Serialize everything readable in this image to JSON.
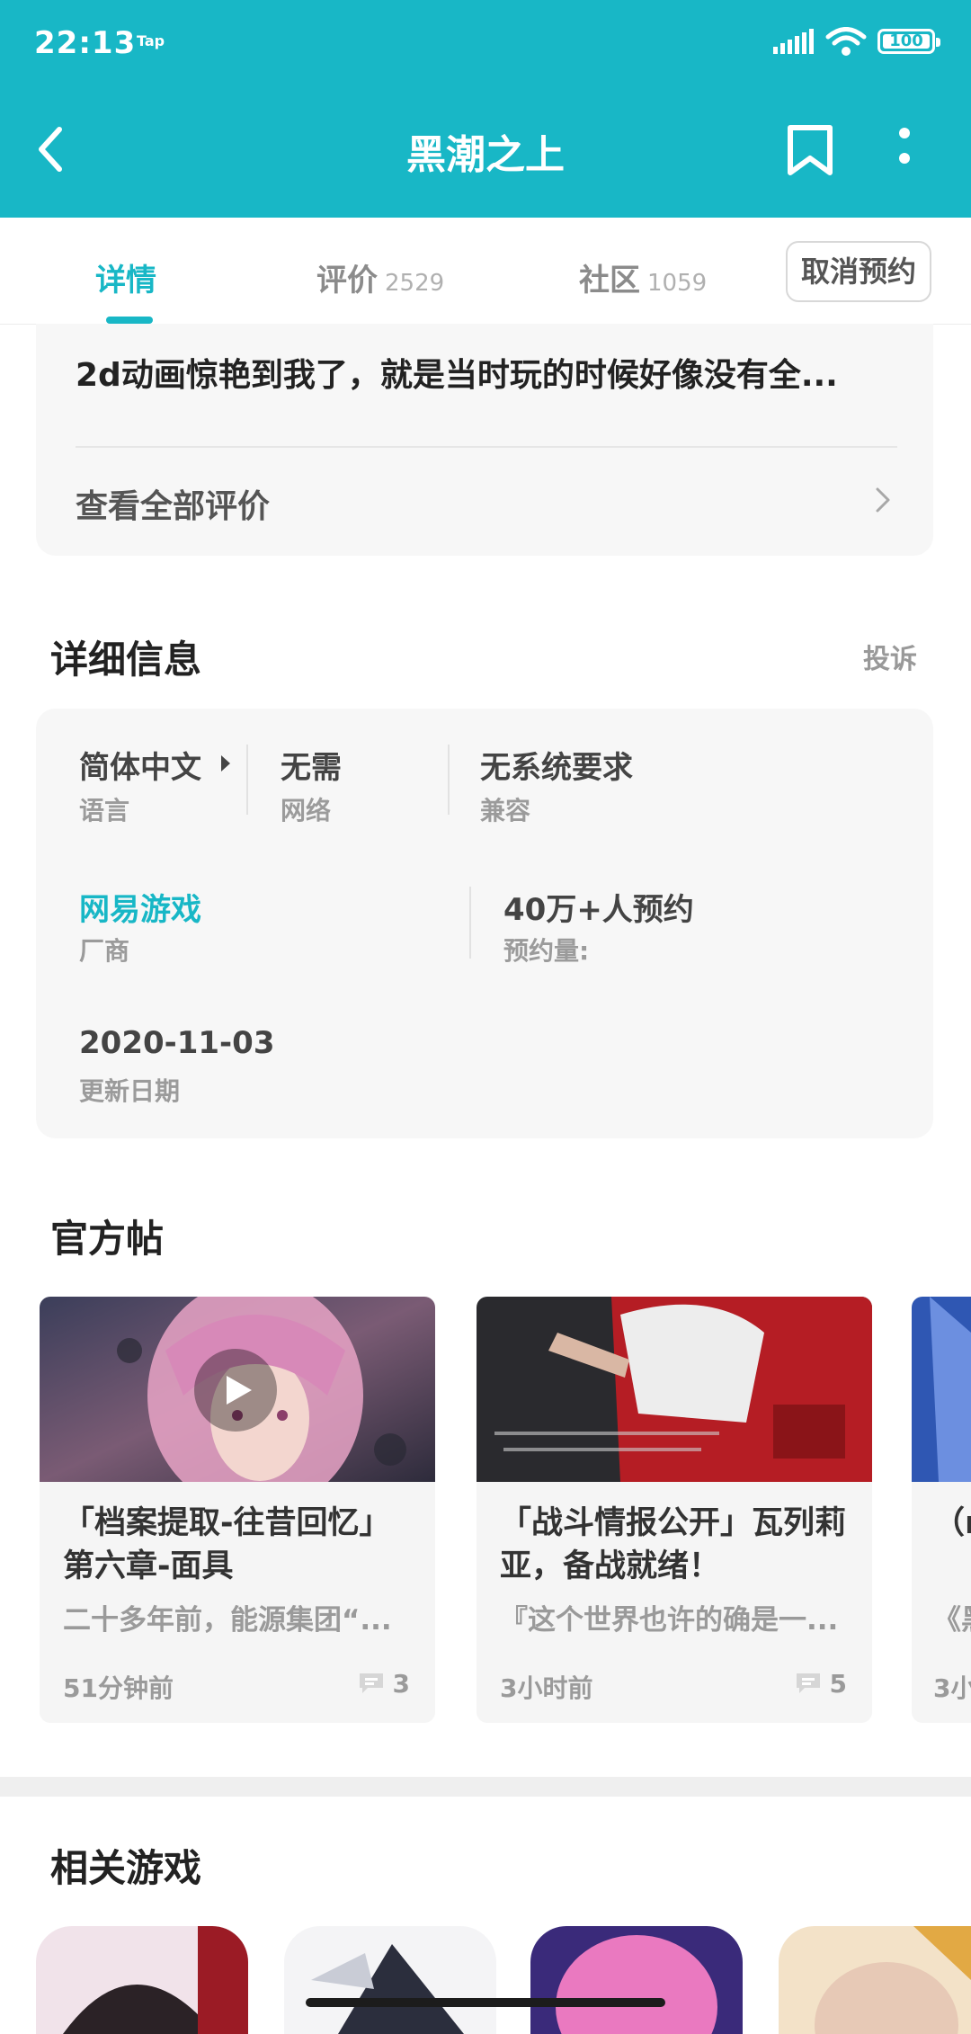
{
  "status_bar": {
    "time": "22:13",
    "tag": "Tap",
    "battery": "100"
  },
  "header": {
    "title": "黑潮之上"
  },
  "tabs": [
    {
      "label": "详情",
      "count": ""
    },
    {
      "label": "评价",
      "count": "2529"
    },
    {
      "label": "社区",
      "count": "1059"
    }
  ],
  "reserve_button": "取消预约",
  "review": {
    "snippet": "2d动画惊艳到我了，就是当时玩的时候好像没有全...",
    "view_all": "查看全部评价"
  },
  "details": {
    "title": "详细信息",
    "report": "投诉",
    "items": [
      {
        "value": "简体中文",
        "label": "语言"
      },
      {
        "value": "无需",
        "label": "网络"
      },
      {
        "value": "无系统要求",
        "label": "兼容"
      },
      {
        "value": "网易游戏",
        "label": "厂商"
      },
      {
        "value": "40万+人预约",
        "label": "预约量:"
      },
      {
        "value": "2020-11-03",
        "label": "更新日期"
      }
    ]
  },
  "official_posts": {
    "title": "官方帖",
    "posts": [
      {
        "title": "「档案提取-往昔回忆」第六章-面具",
        "excerpt": "二十多年前，能源集团“...",
        "time": "51分钟前",
        "comments": "3"
      },
      {
        "title": "「战斗情报公开」瓦列莉亚，备战就绪！",
        "excerpt": "『这个世界也许的确是一...",
        "time": "3小时前",
        "comments": "5"
      },
      {
        "title": "（n",
        "excerpt": "《黑",
        "time": "3小",
        "comments": ""
      }
    ]
  },
  "related": {
    "title": "相关游戏"
  },
  "colors": {
    "accent": "#18b7c6",
    "card_bg": "#f7f7f7"
  }
}
